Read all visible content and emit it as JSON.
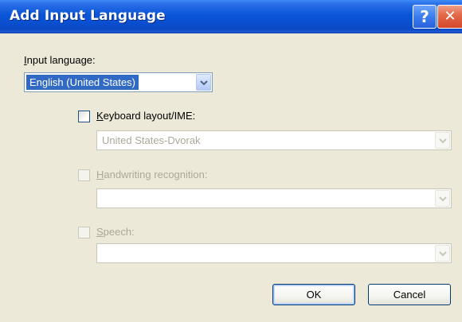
{
  "window": {
    "title": "Add Input Language"
  },
  "titlebar": {
    "help_glyph": "?",
    "close_glyph": "✕"
  },
  "input_language": {
    "label_accel": "I",
    "label_rest": "nput language:",
    "value": "English (United States)"
  },
  "keyboard": {
    "label_accel": "K",
    "label_rest": "eyboard layout/IME:",
    "checked": false,
    "enabled": true,
    "value": "United States-Dvorak",
    "value_enabled": false
  },
  "handwriting": {
    "label_accel": "H",
    "label_rest": "andwriting recognition:",
    "checked": false,
    "enabled": false,
    "value": ""
  },
  "speech": {
    "label_accel": "S",
    "label_rest": "peech:",
    "checked": false,
    "enabled": false,
    "value": ""
  },
  "buttons": {
    "ok": "OK",
    "cancel": "Cancel"
  },
  "colors": {
    "titlebar": "#0a56d8",
    "dialog_bg": "#ece9d8",
    "selection": "#316ac5",
    "disabled_text": "#aca899"
  },
  "icons": {
    "help": "question-mark-icon",
    "close": "close-x-icon",
    "dropdown": "chevron-down-icon"
  }
}
